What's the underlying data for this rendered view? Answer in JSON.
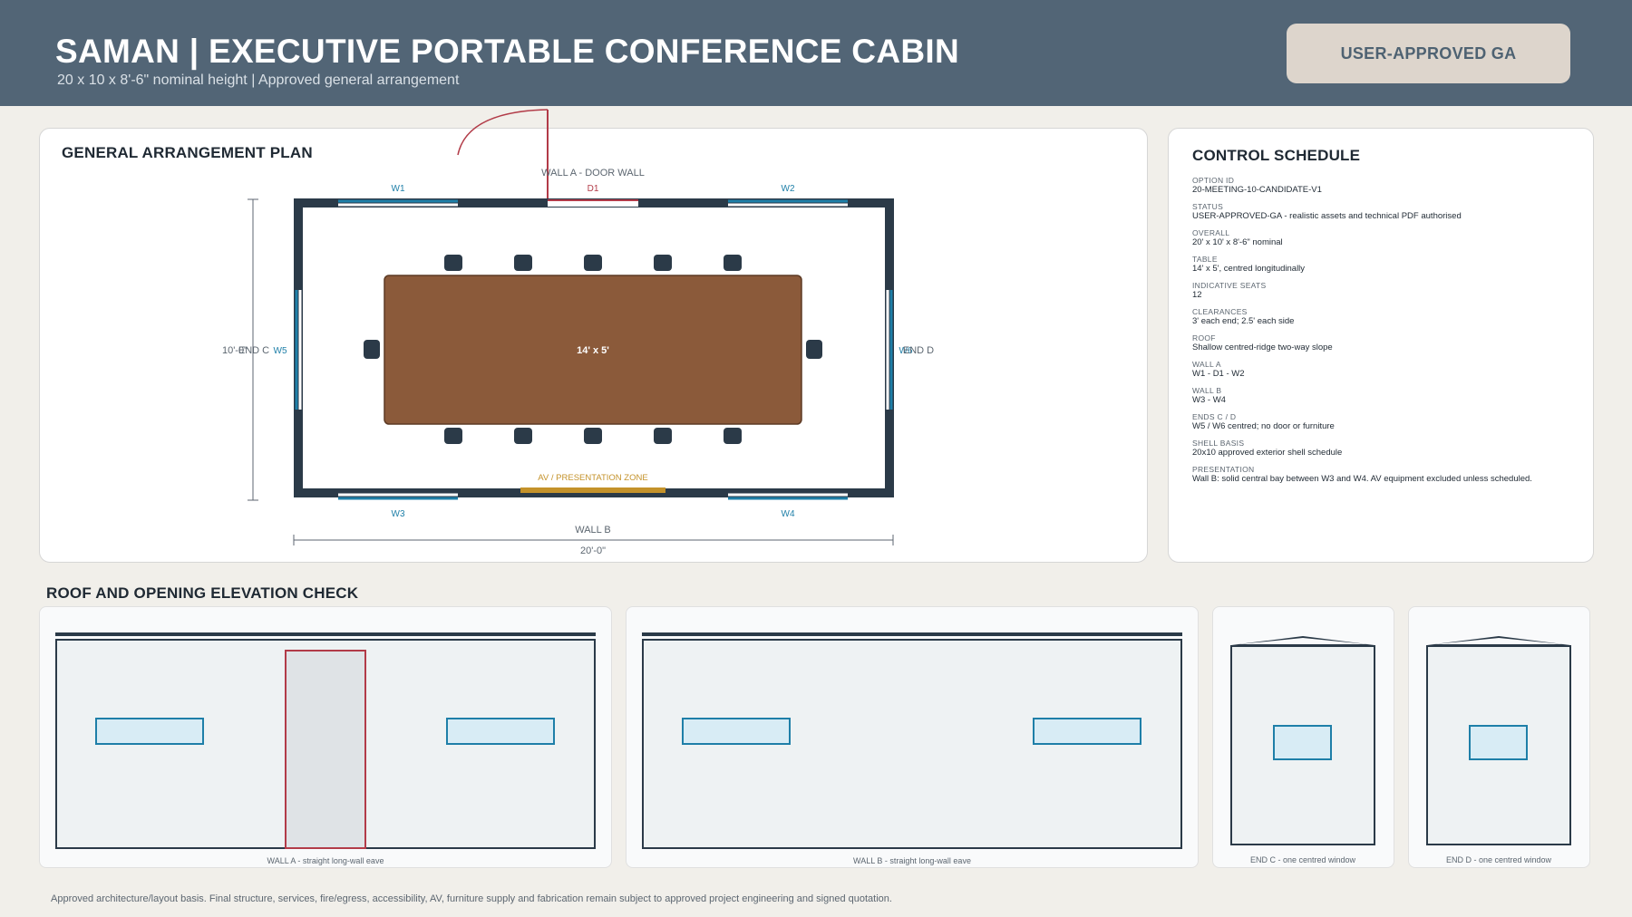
{
  "header": {
    "title": "SAMAN | EXECUTIVE PORTABLE CONFERENCE CABIN",
    "subtitle": "20 x 10 x 8'-6\" nominal height | Approved general arrangement",
    "badge": "USER-APPROVED GA"
  },
  "plan": {
    "title": "GENERAL ARRANGEMENT PLAN",
    "wall_a_label": "WALL A - DOOR WALL",
    "wall_b_label": "WALL B",
    "end_c_label": "END C",
    "end_d_label": "END D",
    "width_dim": "20'-0\"",
    "depth_dim": "10'-0\"",
    "table_label": "14' x 5'",
    "av_label": "AV / PRESENTATION ZONE",
    "openings": {
      "w1": "W1",
      "w2": "W2",
      "w3": "W3",
      "w4": "W4",
      "w5": "W5",
      "w6": "W6",
      "d1": "D1"
    }
  },
  "schedule": {
    "title": "CONTROL SCHEDULE",
    "items": [
      {
        "label": "OPTION ID",
        "value": "20-MEETING-10-CANDIDATE-V1"
      },
      {
        "label": "STATUS",
        "value": "USER-APPROVED-GA - realistic assets and technical PDF authorised"
      },
      {
        "label": "OVERALL",
        "value": "20' x 10' x 8'-6\" nominal"
      },
      {
        "label": "TABLE",
        "value": "14' x 5', centred longitudinally"
      },
      {
        "label": "INDICATIVE SEATS",
        "value": "12"
      },
      {
        "label": "CLEARANCES",
        "value": "3' each end; 2.5' each side"
      },
      {
        "label": "ROOF",
        "value": "Shallow centred-ridge two-way slope"
      },
      {
        "label": "WALL A",
        "value": "W1 - D1 - W2"
      },
      {
        "label": "WALL B",
        "value": "W3 - W4"
      },
      {
        "label": "ENDS C / D",
        "value": "W5 / W6 centred; no door or furniture"
      },
      {
        "label": "SHELL BASIS",
        "value": "20x10 approved exterior shell schedule"
      },
      {
        "label": "PRESENTATION",
        "value": "Wall B: solid central bay between W3 and W4. AV equipment excluded unless scheduled."
      }
    ]
  },
  "elevations": {
    "title": "ROOF AND OPENING ELEVATION CHECK",
    "wall_a_caption": "WALL A - straight long-wall eave",
    "wall_b_caption": "WALL B - straight long-wall eave",
    "end_c_caption": "END C - one centred window",
    "end_d_caption": "END D - one centred window"
  },
  "footer": "Approved architecture/layout basis. Final structure, services, fire/egress, accessibility, AV, furniture supply and fabrication remain subject to approved project engineering and signed quotation.",
  "colors": {
    "header": "#526576",
    "wall": "#2b3a48",
    "window": "#1e7fa8",
    "door": "#b23b48",
    "table": "#8b5a3a",
    "av": "#c4922a"
  }
}
